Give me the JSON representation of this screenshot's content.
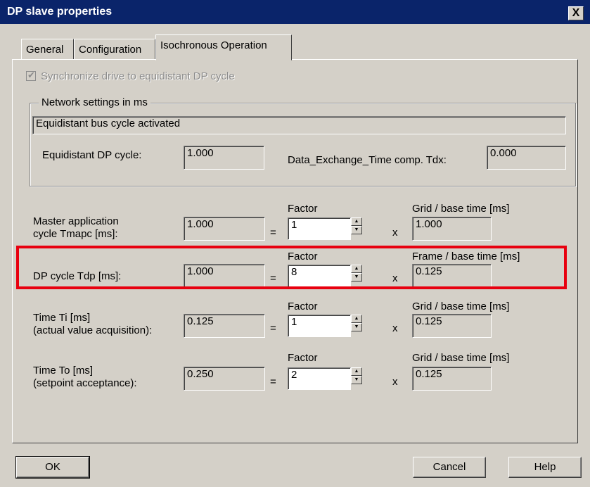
{
  "window": {
    "title": "DP slave properties",
    "close_label": "X"
  },
  "tabs": [
    {
      "label": "General"
    },
    {
      "label": "Configuration"
    },
    {
      "label": "Isochronous Operation"
    }
  ],
  "sync": {
    "label": "Synchronize drive to equidistant DP cycle",
    "checked": true,
    "disabled": true
  },
  "network": {
    "group_label": "Network settings in ms",
    "status": "Equidistant bus cycle activated",
    "dp_cycle_label": "Equidistant DP cycle:",
    "dp_cycle_value": "1.000",
    "tdx_label": "Data_Exchange_Time comp. Tdx:",
    "tdx_value": "0.000"
  },
  "rows": [
    {
      "label_1": "Master application",
      "label_2": "cycle Tmapc [ms]:",
      "value": "1.000",
      "eq": "=",
      "factor_label": "Factor",
      "factor": "1",
      "x": "x",
      "base_label": "Grid / base time [ms]",
      "base": "1.000"
    },
    {
      "label_1": "DP cycle Tdp [ms]:",
      "label_2": "",
      "value": "1.000",
      "eq": "=",
      "factor_label": "Factor",
      "factor": "8",
      "x": "x",
      "base_label": "Frame / base time [ms]",
      "base": "0.125"
    },
    {
      "label_1": "Time Ti  [ms]",
      "label_2": "(actual value acquisition):",
      "value": "0.125",
      "eq": "=",
      "factor_label": "Factor",
      "factor": "1",
      "x": "x",
      "base_label": "Grid / base time [ms]",
      "base": "0.125"
    },
    {
      "label_1": "Time To  [ms]",
      "label_2": "(setpoint acceptance):",
      "value": "0.250",
      "eq": "=",
      "factor_label": "Factor",
      "factor": "2",
      "x": "x",
      "base_label": "Grid / base time [ms]",
      "base": "0.125"
    }
  ],
  "buttons": {
    "ok": "OK",
    "cancel": "Cancel",
    "help": "Help"
  },
  "colors": {
    "title_bar": "#0a246a",
    "highlight": "#e8000f",
    "dialog": "#d4d0c8"
  }
}
